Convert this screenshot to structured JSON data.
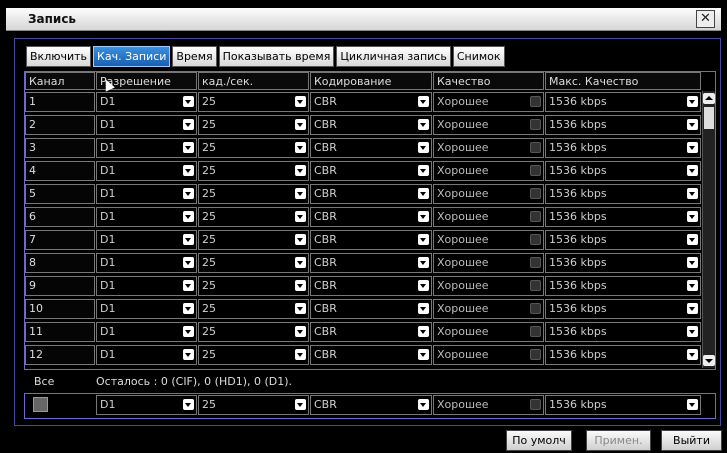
{
  "window": {
    "title": "Запись",
    "close_glyph": "✕"
  },
  "tabs": [
    "Включить",
    "Кач. Записи",
    "Время",
    "Показывать время",
    "Цикличная запись",
    "Снимок"
  ],
  "active_tab_index": 1,
  "table": {
    "columns": [
      "Канал",
      "Разрешение",
      "кад./сек.",
      "Кодирование",
      "Качество",
      "Макс. Качество"
    ],
    "rows": [
      {
        "channel": "1",
        "resolution": "D1",
        "fps": "25",
        "encoding": "CBR",
        "quality": "Хорошее",
        "max_quality": "1536 kbps"
      },
      {
        "channel": "2",
        "resolution": "D1",
        "fps": "25",
        "encoding": "CBR",
        "quality": "Хорошее",
        "max_quality": "1536 kbps"
      },
      {
        "channel": "3",
        "resolution": "D1",
        "fps": "25",
        "encoding": "CBR",
        "quality": "Хорошее",
        "max_quality": "1536 kbps"
      },
      {
        "channel": "4",
        "resolution": "D1",
        "fps": "25",
        "encoding": "CBR",
        "quality": "Хорошее",
        "max_quality": "1536 kbps"
      },
      {
        "channel": "5",
        "resolution": "D1",
        "fps": "25",
        "encoding": "CBR",
        "quality": "Хорошее",
        "max_quality": "1536 kbps"
      },
      {
        "channel": "6",
        "resolution": "D1",
        "fps": "25",
        "encoding": "CBR",
        "quality": "Хорошее",
        "max_quality": "1536 kbps"
      },
      {
        "channel": "7",
        "resolution": "D1",
        "fps": "25",
        "encoding": "CBR",
        "quality": "Хорошее",
        "max_quality": "1536 kbps"
      },
      {
        "channel": "8",
        "resolution": "D1",
        "fps": "25",
        "encoding": "CBR",
        "quality": "Хорошее",
        "max_quality": "1536 kbps"
      },
      {
        "channel": "9",
        "resolution": "D1",
        "fps": "25",
        "encoding": "CBR",
        "quality": "Хорошее",
        "max_quality": "1536 kbps"
      },
      {
        "channel": "10",
        "resolution": "D1",
        "fps": "25",
        "encoding": "CBR",
        "quality": "Хорошее",
        "max_quality": "1536 kbps"
      },
      {
        "channel": "11",
        "resolution": "D1",
        "fps": "25",
        "encoding": "CBR",
        "quality": "Хорошее",
        "max_quality": "1536 kbps"
      },
      {
        "channel": "12",
        "resolution": "D1",
        "fps": "25",
        "encoding": "CBR",
        "quality": "Хорошее",
        "max_quality": "1536 kbps"
      }
    ]
  },
  "all_row": {
    "label": "Все",
    "remaining_text": "Осталось : 0 (CIF), 0 (HD1), 0 (D1).",
    "resolution": "D1",
    "fps": "25",
    "encoding": "CBR",
    "quality": "Хорошее",
    "max_quality": "1536 kbps"
  },
  "buttons": {
    "default": "По умолч",
    "apply": "Примен.",
    "exit": "Выйти"
  },
  "colors": {
    "active_tab": "#2a78d0",
    "panel_border": "#4a4aa0",
    "background": "#000000"
  }
}
